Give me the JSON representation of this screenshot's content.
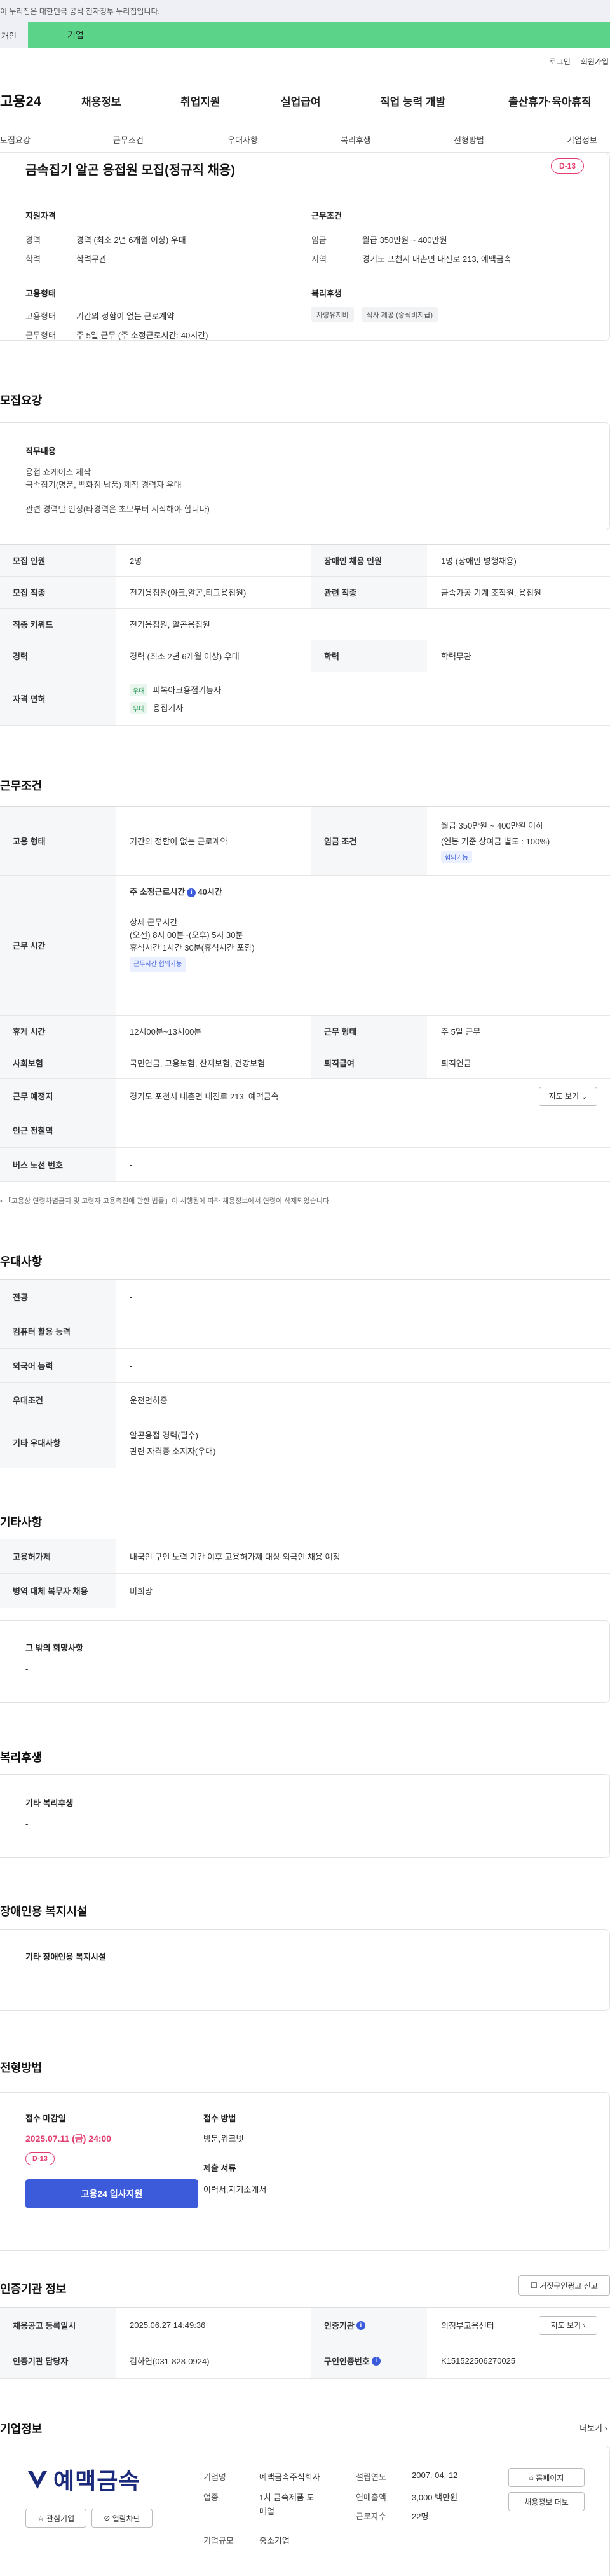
{
  "gov_banner": "이 누리집은 대한민국 공식 전자정부 누리집입니다.",
  "user_tabs": {
    "individual": "개인",
    "enterprise": "기업"
  },
  "top_links": {
    "login": "로그인",
    "signup": "회원가입"
  },
  "logo": "고용24",
  "main_nav": [
    "채용정보",
    "취업지원",
    "실업급여",
    "직업 능력 개발",
    "출산휴가·육아휴직"
  ],
  "sub_nav": [
    "모집요강",
    "근무조건",
    "우대사항",
    "복리후생",
    "전형방법",
    "기업정보"
  ],
  "summary": {
    "title": "금속집기 알곤 용접원 모집(정규직 채용)",
    "dday": "D-13",
    "qual_title": "지원자격",
    "career_label": "경력",
    "career_value": "경력 (최소 2년 6개월 이상) 우대",
    "edu_label": "학력",
    "edu_value": "학력무관",
    "work_title": "근무조건",
    "wage_label": "임금",
    "wage_value": "월급 350만원 ~ 400만원",
    "region_label": "지역",
    "region_value": "경기도 포천시 내촌면 내진로 213, 예맥금속",
    "emp_title": "고용형태",
    "emptype_label": "고용형태",
    "emptype_value": "기간의 정함이 없는 근로계약",
    "worktype_label": "근무형태",
    "worktype_value": "주 5일 근무 (주 소정근로시간: 40시간)",
    "welfare_title": "복리후생",
    "welfare_chips": [
      "차량유지비",
      "식사 제공 (중식비지급)"
    ]
  },
  "recruit": {
    "heading": "모집요강",
    "job_title": "직무내용",
    "job_lines": [
      "용접 쇼케이스 제작",
      "금속집기(명품, 백화점 납품) 제작 경력자 우대",
      "",
      "관련 경력만 인정(타경력은 초보부터 시작해야 합니다)"
    ],
    "r1": {
      "h1": "모집 인원",
      "v1": "2명",
      "h2": "장애인 채용 인원",
      "v2": "1명 (장애인 병행채용)"
    },
    "r2": {
      "h1": "모집 직종",
      "v1": "전기용접원(아크,알곤,티그용접원)",
      "h2": "관련 직종",
      "v2": "금속가공 기계 조작원, 용접원"
    },
    "r3": {
      "h1": "직종 키워드",
      "v1": "전기용접원, 알곤용접원"
    },
    "r4": {
      "h1": "경력",
      "v1": "경력 (최소 2년 6개월 이상) 우대",
      "h2": "학력",
      "v2": "학력무관"
    },
    "r5": {
      "h1": "자격 면허",
      "tag": "우대",
      "lic1": "피복아크용접기능사",
      "lic2": "용접기사"
    }
  },
  "conditions": {
    "heading": "근무조건",
    "emp_h": "고용 형태",
    "emp_v": "기간의 정함이 없는 근로계약",
    "wage_h": "임금 조건",
    "wage_v1": "월급 350만원 ~ 400만원 이하",
    "wage_v2": "(연봉 기준 상여금 별도 : 100%)",
    "wage_tag": "협의가능",
    "hours_h": "근무 시간",
    "hours_title": "주 소정근로시간",
    "hours_value": "40시간",
    "hours_detail_title": "상세 근무시간",
    "hours_detail_1": "(오전) 8시 00분~(오후) 5시 30분",
    "hours_detail_2": "휴식시간 1시간 30분(휴식시간 포함)",
    "hours_tag": "근무시간 협의가능",
    "break_h": "휴게 시간",
    "break_v": "12시00분~13시00분",
    "form_h": "근무 형태",
    "form_v": "주 5일 근무",
    "ins_h": "사회보험",
    "ins_v": "국민연금, 고용보험, 산재보험, 건강보험",
    "ret_h": "퇴직급여",
    "ret_v": "퇴직연금",
    "place_h": "근무 예정지",
    "place_v": "경기도 포천시 내촌면 내진로 213, 예맥금속",
    "map_btn": "지도 보기",
    "station_h": "인근 전철역",
    "station_v": "-",
    "bus_h": "버스 노선 번호",
    "bus_v": "-",
    "note": "「고용상 연령차별금지 및 고령자 고용촉진에 관한 법률」이 시행됨에 따라 채용정보에서 연령이 삭제되었습니다."
  },
  "pref": {
    "heading": "우대사항",
    "rows": [
      {
        "h": "전공",
        "v": "-"
      },
      {
        "h": "컴퓨터 활용 능력",
        "v": "-"
      },
      {
        "h": "외국어 능력",
        "v": "-"
      },
      {
        "h": "우대조건",
        "v": "운전면허증"
      }
    ],
    "other_h": "기타 우대사항",
    "other_v1": "알곤용접 경력(필수)",
    "other_v2": "관련 자격증 소지자(우대)"
  },
  "etc": {
    "heading": "기타사항",
    "r1_h": "고용허가제",
    "r1_v": "내국인 구인 노력 기간 이후 고용허가제 대상 외국인 채용 예정",
    "r2_h": "병역 대체 복무자 채용",
    "r2_v": "비희망",
    "other_title": "그 밖의 희망사항",
    "other_v": "-"
  },
  "welfare": {
    "heading": "복리후생",
    "title": "기타 복리후생",
    "v": "-"
  },
  "disabled": {
    "heading": "장애인용 복지시설",
    "title": "기타 장애인용 복지시설",
    "v": "-"
  },
  "process": {
    "heading": "전형방법",
    "deadline_label": "접수 마감일",
    "deadline": "2025.07.11 (금) 24:00",
    "dday": "D-13",
    "apply_btn": "고용24 입사지원",
    "method_label": "접수 방법",
    "method_v": "방문,워크넷",
    "docs_label": "제출 서류",
    "docs_v": "이력서,자기소개서"
  },
  "cert": {
    "heading": "인증기관 정보",
    "report_btn": "거짓구인광고 신고",
    "r1_h": "채용공고 등록일시",
    "r1_v": "2025.06.27 14:49:36",
    "r1_h2": "인증기관",
    "r1_v2": "의정부고용센터",
    "map_btn": "지도 보기",
    "r2_h": "인증기관 담당자",
    "r2_v": "김하연(031-828-0924)",
    "r2_h2": "구인인증번호",
    "r2_v2": "K151522506270025"
  },
  "company": {
    "heading": "기업정보",
    "more": "더보기",
    "logo_text": "예맥금속",
    "interest_btn": "관심기업",
    "block_btn": "열람차단",
    "name_h": "기업명",
    "name_v": "예맥금속주식회사",
    "biz_h": "업종",
    "biz_v1": "1차 금속제품 도",
    "biz_v2": "매업",
    "scale_h": "기업규모",
    "scale_v": "중소기업",
    "found_h": "설립연도",
    "found_v": "2007. 04. 12",
    "sales_h": "연매출액",
    "sales_v": "3,000 백만원",
    "staff_h": "근로자수",
    "staff_v": "22명",
    "homepage_btn": "홈페이지",
    "jobs_btn": "채용정보 더보"
  },
  "colors": {
    "accent": "#5bd48a",
    "dday": "#e23b6e",
    "primary_btn": "#3b5bdb"
  }
}
